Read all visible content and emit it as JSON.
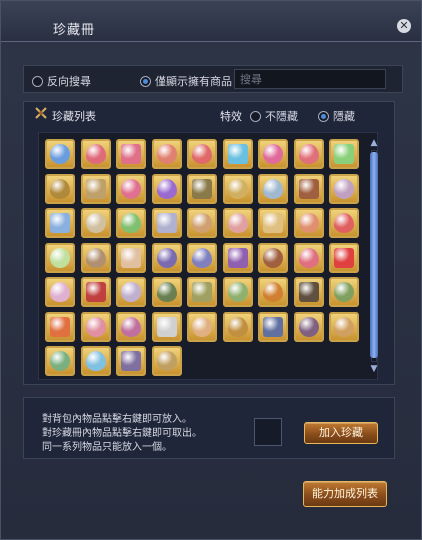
{
  "window": {
    "title": "珍藏冊",
    "close_label": "✕"
  },
  "search": {
    "reverse_search_label": "反向搜尋",
    "owned_only_label": "僅顯示擁有商品",
    "placeholder": "搜尋",
    "value": "",
    "reverse_selected": false,
    "owned_only_selected": true
  },
  "list": {
    "title": "珍藏列表",
    "effect_label": "特效",
    "show_label": "不隱藏",
    "hide_label": "隱藏",
    "hide_selected": true,
    "rows": [
      [
        "#6a9de0",
        "#e06a7a",
        "#e0708a",
        "#e08070",
        "#e06a6a",
        "#6ac0e0",
        "#e06a9a",
        "#e0707a",
        "#8ad07a"
      ],
      [
        "#b08a3a",
        "#c0a06a",
        "#e07090",
        "#9a6ad0",
        "#8a7a4a",
        "#d0b060",
        "#a0b8d0",
        "#a06040",
        "#c0a0c0"
      ],
      [
        "#8ab0e0",
        "#d0c0a0",
        "#80c070",
        "#b0b0d0",
        "#d0a070",
        "#e0a0a0",
        "#e0c080",
        "#e09070",
        "#e06060"
      ],
      [
        "#c0e0a0",
        "#b09070",
        "#e0c0a0",
        "#7a6ab0",
        "#8080c0",
        "#9060b0",
        "#a06040",
        "#e07080",
        "#e04040"
      ],
      [
        "#e0b0d0",
        "#c04040",
        "#c0b0d0",
        "#6a8050",
        "#a0a060",
        "#90b070",
        "#d08030",
        "#605040",
        "#80a060"
      ],
      [
        "#e07040",
        "#e090a0",
        "#c070a0",
        "#d0d0d0",
        "#e0b080",
        "#c09040",
        "#6070a0",
        "#806080",
        "#d0a060"
      ],
      [
        "#7ab080",
        "#80c0e0",
        "#8070a0",
        "#c0a060"
      ]
    ]
  },
  "info": {
    "line1": "對背包內物品點擊右鍵即可放入。",
    "line2": "對珍藏冊內物品點擊右鍵即可取出。",
    "line3": "同一系列物品只能放入一個。",
    "add_button": "加入珍藏"
  },
  "footer": {
    "effects_list_button": "能力加成列表"
  },
  "colors": {
    "accent_gold": "#c9a24a",
    "panel": "#20263a",
    "scroll": "#8fb0f0"
  }
}
